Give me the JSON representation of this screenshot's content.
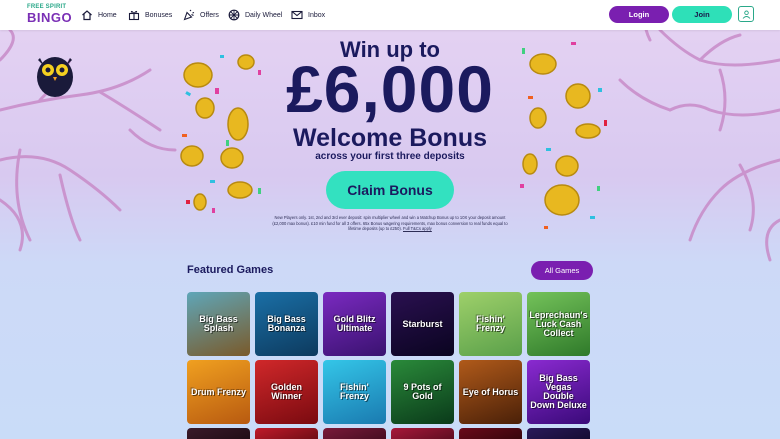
{
  "nav": {
    "logo_top": "FREE SPIRIT",
    "logo_bottom": "BINGO",
    "items": [
      {
        "label": "Home",
        "icon": "home-icon"
      },
      {
        "label": "Bonuses",
        "icon": "gift-icon"
      },
      {
        "label": "Offers",
        "icon": "party-popper-icon"
      },
      {
        "label": "Daily Wheel",
        "icon": "wheel-icon"
      },
      {
        "label": "Inbox",
        "icon": "mail-icon"
      }
    ],
    "login_label": "Login",
    "join_label": "Join",
    "account_icon": "user-icon"
  },
  "hero": {
    "line1": "Win up to",
    "amount": "£6,000",
    "line2": "Welcome Bonus",
    "line3": "across your first three deposits",
    "cta_label": "Claim Bonus",
    "terms_text": "New Players only. 1st, 2nd and 3rd ever deposit: spin multiplier wheel and win a Matchup Bonus up to 10X your deposit amount (£2,000 max bonus). £10 min fund for all 3 offers. 65x Bonus wagering requirements, max bonus conversion to real funds equal to lifetime deposits (up to £250).",
    "terms_link": "Full T&Cs apply"
  },
  "featured": {
    "title": "Featured Games",
    "all_label": "All Games",
    "games": [
      {
        "name": "Big Bass Splash",
        "bg1": "#5fa6b8",
        "bg2": "#7a5a2a"
      },
      {
        "name": "Big Bass Bonanza",
        "bg1": "#1a6fa6",
        "bg2": "#0d3a5e"
      },
      {
        "name": "Gold Blitz Ultimate",
        "bg1": "#7a2ac0",
        "bg2": "#3a1270"
      },
      {
        "name": "Starburst",
        "bg1": "#2a1050",
        "bg2": "#0a0420"
      },
      {
        "name": "Fishin' Frenzy",
        "bg1": "#9ed06a",
        "bg2": "#5aa04a"
      },
      {
        "name": "Leprechaun's Luck Cash Collect",
        "bg1": "#74c25a",
        "bg2": "#2f7a2a"
      },
      {
        "name": "Drum Frenzy",
        "bg1": "#f0a020",
        "bg2": "#b85a10"
      },
      {
        "name": "Golden Winner",
        "bg1": "#d0282a",
        "bg2": "#7a0a10"
      },
      {
        "name": "Fishin' Frenzy",
        "bg1": "#34c6e8",
        "bg2": "#1a7ab0"
      },
      {
        "name": "9 Pots of Gold",
        "bg1": "#2a8a3a",
        "bg2": "#0a3a1a"
      },
      {
        "name": "Eye of Horus",
        "bg1": "#b05a1a",
        "bg2": "#4a2008"
      },
      {
        "name": "Big Bass Vegas Double Down Deluxe",
        "bg1": "#8a2ad0",
        "bg2": "#3a0a7a"
      },
      {
        "name": "",
        "bg1": "#3a1a2a",
        "bg2": "#1a0a10"
      },
      {
        "name": "",
        "bg1": "#c01a2a",
        "bg2": "#5a0a10"
      },
      {
        "name": "",
        "bg1": "#7a1a3a",
        "bg2": "#3a0a1a"
      },
      {
        "name": "",
        "bg1": "#a8183a",
        "bg2": "#4a0a1a"
      },
      {
        "name": "",
        "bg1": "#6a0a1a",
        "bg2": "#2a0408"
      },
      {
        "name": "",
        "bg1": "#2a1a5a",
        "bg2": "#100828"
      }
    ]
  },
  "colors": {
    "brand_purple": "#7a1fb0",
    "brand_teal": "#33e1c0",
    "text_navy": "#1b1a5e"
  }
}
